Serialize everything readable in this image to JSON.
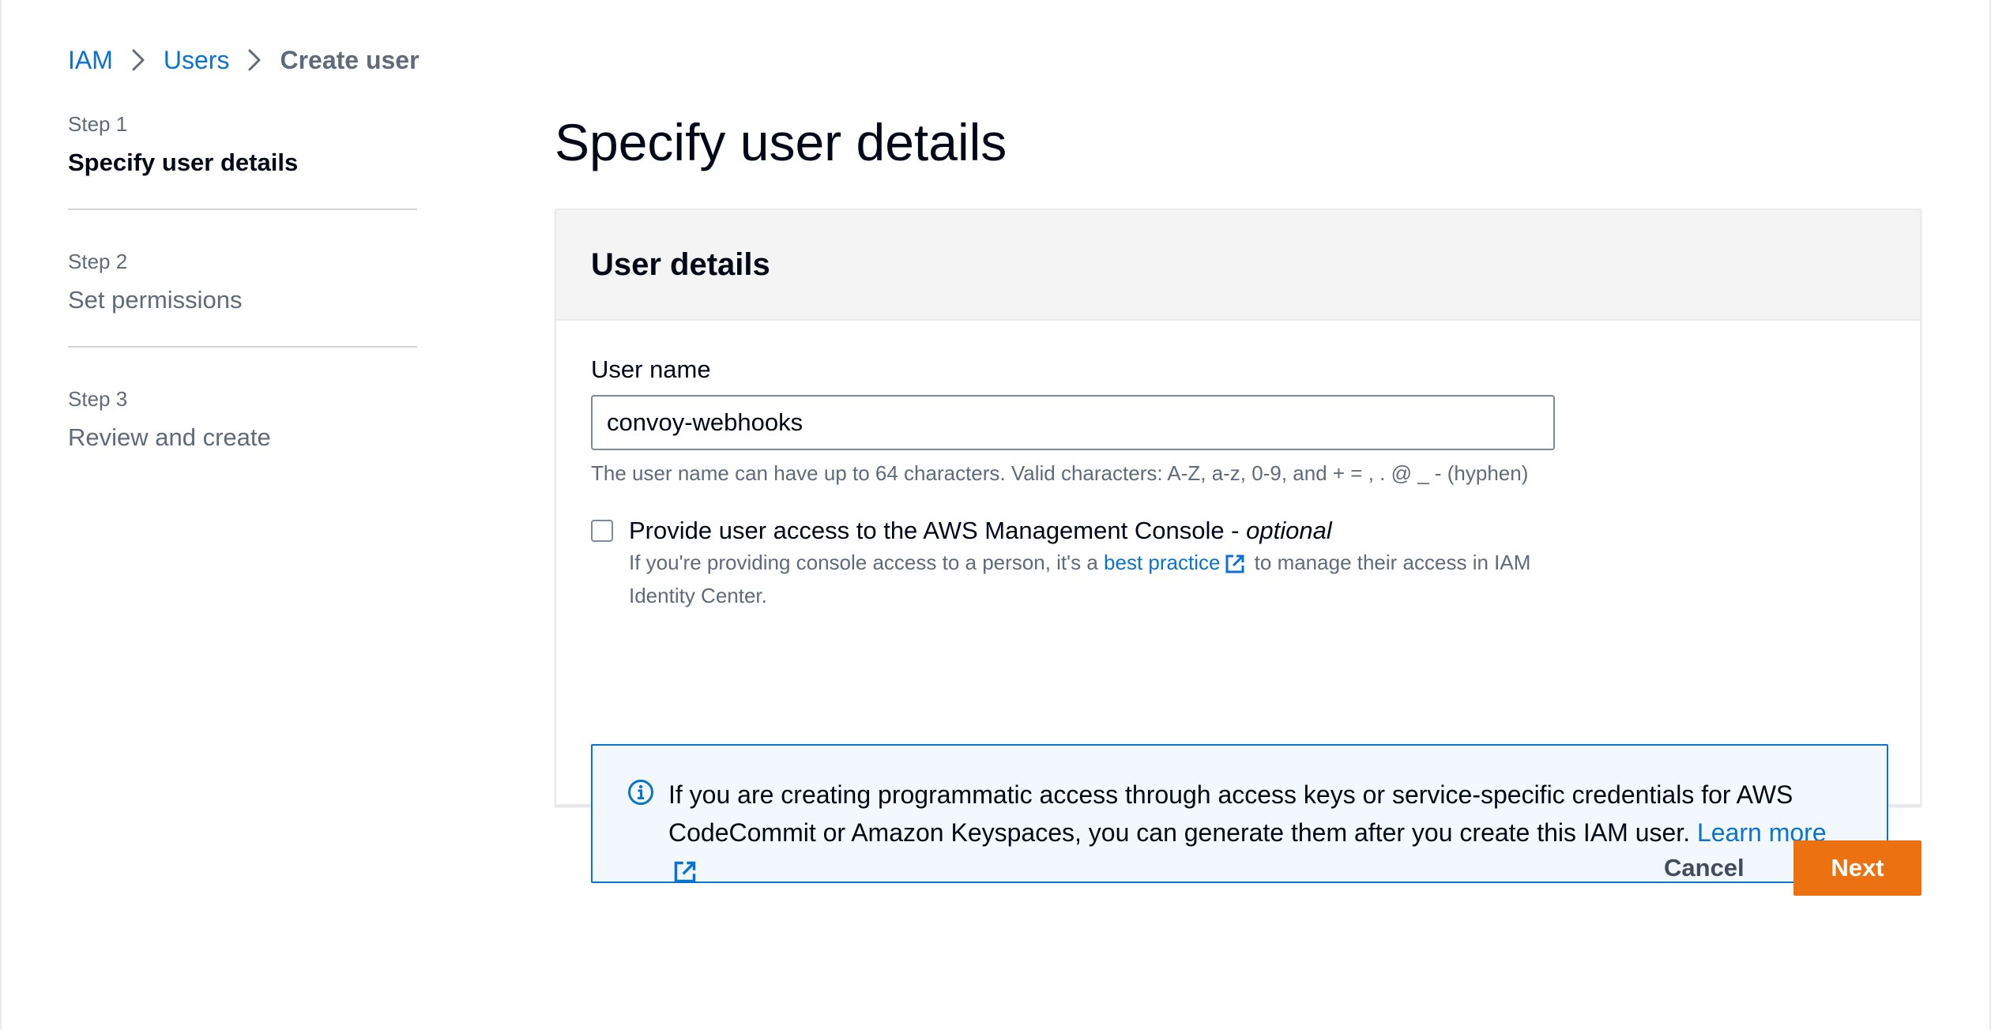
{
  "breadcrumb": {
    "items": [
      "IAM",
      "Users",
      "Create user"
    ]
  },
  "steps": [
    {
      "number": "Step 1",
      "title": "Specify user details",
      "active": true
    },
    {
      "number": "Step 2",
      "title": "Set permissions",
      "active": false
    },
    {
      "number": "Step 3",
      "title": "Review and create",
      "active": false
    }
  ],
  "page_title": "Specify user details",
  "container": {
    "header": "User details",
    "user_name": {
      "label": "User name",
      "value": "convoy-webhooks",
      "hint": "The user name can have up to 64 characters. Valid characters: A-Z, a-z, 0-9, and + = , . @ _ - (hyphen)"
    },
    "console_access": {
      "label": "Provide user access to the AWS Management Console - ",
      "label_optional": "optional",
      "checked": false,
      "desc_prefix": "If you're providing console access to a person, it's a ",
      "desc_link": "best practice",
      "desc_suffix": " to manage their access in IAM Identity Center."
    },
    "info_alert": {
      "text": "If you are creating programmatic access through access keys or service-specific credentials for AWS CodeCommit or Amazon Keyspaces, you can generate them after you create this IAM user. ",
      "link": "Learn more"
    }
  },
  "actions": {
    "cancel": "Cancel",
    "next": "Next"
  },
  "icons": {
    "breadcrumb_separator": "chevron-right-icon",
    "external_link": "external-link-icon",
    "info": "info-icon"
  },
  "colors": {
    "link": "#0972d3",
    "primary_button": "#ec7211",
    "info_background": "#f2f8fd",
    "info_border": "#0972d3"
  }
}
